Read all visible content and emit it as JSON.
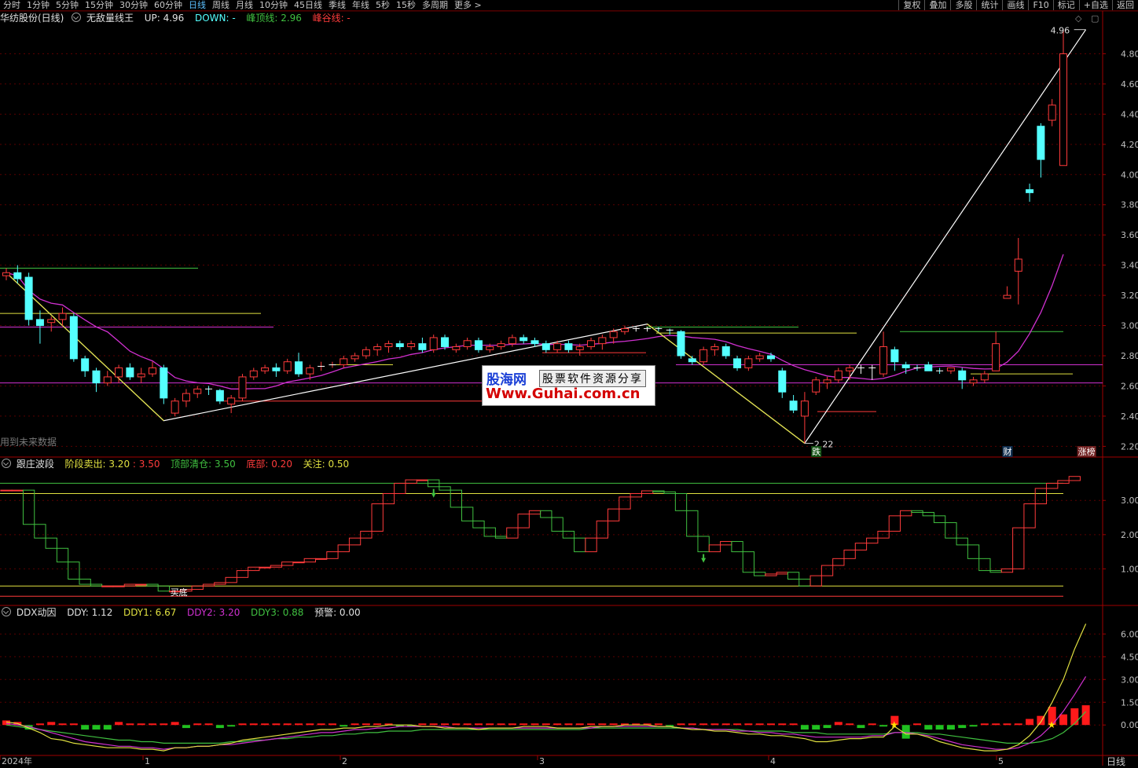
{
  "toolbar": {
    "tabs": [
      "分时",
      "1分钟",
      "5分钟",
      "15分钟",
      "30分钟",
      "60分钟",
      "日线",
      "周线",
      "月线",
      "10分钟",
      "45日线",
      "季线",
      "年线",
      "5秒",
      "15秒",
      "多周期",
      "更多 >"
    ],
    "active_index": 6,
    "right_buttons": [
      "复权",
      "叠加",
      "多股",
      "统计",
      "画线",
      "F10",
      "标记",
      "+自选",
      "返回"
    ]
  },
  "main_panel": {
    "stock_name": "华纺股份(日线)",
    "indicator_name": "无敌量线王",
    "up_label": "UP: 4.96",
    "down_label": "DOWN: -",
    "peak_label": "峰顶线: 2.96",
    "valley_label": "峰谷线: -",
    "future_data_note": "用到未来数据",
    "high_marker": "4.96",
    "low_marker": "2.22",
    "event_labels": [
      "跌",
      "财",
      "涨榜"
    ],
    "colors": {
      "up": "#ff3b3b",
      "down": "#54ffff",
      "ma": "#d030d0",
      "zigzag": "#ffffff",
      "green_line": "#40c040",
      "yellow_line": "#e0e040"
    }
  },
  "wave_panel": {
    "name": "跟庄波段",
    "stage_sell_label": "阶段卖出: 3.20",
    "value2": ": 3.50",
    "top_clear_label": "顶部清仓: 3.50",
    "bottom_label": "底部: 0.20",
    "attention_label": "关注: 0.50",
    "buy_label": "买底"
  },
  "ddx_panel": {
    "name": "DDX动因",
    "ddy_label": "DDY: 1.12",
    "ddy1_label": "DDY1: 6.67",
    "ddy2_label": "DDY2: 3.20",
    "ddy3_label": "DDY3: 0.88",
    "warn_label": "预警: 0.00"
  },
  "x_axis": {
    "labels": [
      "2024年",
      "1",
      "2",
      "3",
      "4",
      "5"
    ],
    "period_label": "日线"
  },
  "watermark": {
    "brand": "股海网",
    "slogan": "股票软件资源分享",
    "url": "Www.Guhai.com.cn"
  },
  "chart_data": [
    {
      "type": "candlestick",
      "title": "华纺股份(日线)",
      "ylim": [
        2.15,
        5.0
      ],
      "y_ticks": [
        2.2,
        2.4,
        2.6,
        2.8,
        3.0,
        3.2,
        3.4,
        3.6,
        3.8,
        4.0,
        4.2,
        4.4,
        4.6,
        4.8
      ],
      "ohlc": [
        [
          3.33,
          3.38,
          3.3,
          3.35
        ],
        [
          3.35,
          3.4,
          3.28,
          3.31
        ],
        [
          3.32,
          3.35,
          3.0,
          3.04
        ],
        [
          3.04,
          3.1,
          2.88,
          3.0
        ],
        [
          3.02,
          3.06,
          2.96,
          3.04
        ],
        [
          3.04,
          3.12,
          3.0,
          3.08
        ],
        [
          3.06,
          3.08,
          2.76,
          2.78
        ],
        [
          2.78,
          2.8,
          2.66,
          2.7
        ],
        [
          2.7,
          2.72,
          2.56,
          2.62
        ],
        [
          2.62,
          2.7,
          2.6,
          2.66
        ],
        [
          2.66,
          2.74,
          2.62,
          2.72
        ],
        [
          2.72,
          2.75,
          2.64,
          2.66
        ],
        [
          2.66,
          2.72,
          2.62,
          2.68
        ],
        [
          2.68,
          2.76,
          2.66,
          2.72
        ],
        [
          2.72,
          2.74,
          2.48,
          2.52
        ],
        [
          2.42,
          2.52,
          2.4,
          2.5
        ],
        [
          2.5,
          2.58,
          2.46,
          2.55
        ],
        [
          2.55,
          2.6,
          2.52,
          2.58
        ],
        [
          2.58,
          2.6,
          2.54,
          2.57
        ],
        [
          2.57,
          2.58,
          2.48,
          2.5
        ],
        [
          2.48,
          2.54,
          2.42,
          2.52
        ],
        [
          2.52,
          2.68,
          2.5,
          2.66
        ],
        [
          2.66,
          2.72,
          2.64,
          2.7
        ],
        [
          2.7,
          2.74,
          2.68,
          2.72
        ],
        [
          2.72,
          2.75,
          2.66,
          2.7
        ],
        [
          2.7,
          2.78,
          2.68,
          2.76
        ],
        [
          2.76,
          2.82,
          2.66,
          2.68
        ],
        [
          2.68,
          2.74,
          2.64,
          2.72
        ],
        [
          2.72,
          2.76,
          2.7,
          2.73
        ],
        [
          2.73,
          2.76,
          2.72,
          2.74
        ],
        [
          2.74,
          2.8,
          2.72,
          2.78
        ],
        [
          2.78,
          2.82,
          2.76,
          2.8
        ],
        [
          2.8,
          2.86,
          2.78,
          2.84
        ],
        [
          2.84,
          2.88,
          2.8,
          2.86
        ],
        [
          2.86,
          2.9,
          2.82,
          2.88
        ],
        [
          2.88,
          2.9,
          2.84,
          2.86
        ],
        [
          2.86,
          2.9,
          2.84,
          2.88
        ],
        [
          2.88,
          2.92,
          2.82,
          2.84
        ],
        [
          2.84,
          2.94,
          2.82,
          2.92
        ],
        [
          2.92,
          2.94,
          2.84,
          2.86
        ],
        [
          2.84,
          2.88,
          2.82,
          2.86
        ],
        [
          2.86,
          2.92,
          2.84,
          2.9
        ],
        [
          2.9,
          2.92,
          2.82,
          2.84
        ],
        [
          2.84,
          2.88,
          2.82,
          2.86
        ],
        [
          2.86,
          2.9,
          2.84,
          2.88
        ],
        [
          2.88,
          2.94,
          2.86,
          2.92
        ],
        [
          2.92,
          2.94,
          2.88,
          2.9
        ],
        [
          2.9,
          2.92,
          2.86,
          2.88
        ],
        [
          2.88,
          2.9,
          2.82,
          2.84
        ],
        [
          2.84,
          2.9,
          2.82,
          2.88
        ],
        [
          2.88,
          2.9,
          2.82,
          2.84
        ],
        [
          2.84,
          2.88,
          2.8,
          2.86
        ],
        [
          2.86,
          2.92,
          2.84,
          2.9
        ],
        [
          2.88,
          2.94,
          2.84,
          2.92
        ],
        [
          2.92,
          2.98,
          2.88,
          2.96
        ],
        [
          2.96,
          3.0,
          2.94,
          2.98
        ],
        [
          2.98,
          2.99,
          2.96,
          2.98
        ],
        [
          2.98,
          2.99,
          2.96,
          2.98
        ],
        [
          2.98,
          2.99,
          2.96,
          2.97
        ],
        [
          2.97,
          2.98,
          2.94,
          2.96
        ],
        [
          2.96,
          2.97,
          2.78,
          2.8
        ],
        [
          2.78,
          2.8,
          2.74,
          2.76
        ],
        [
          2.76,
          2.86,
          2.74,
          2.84
        ],
        [
          2.84,
          2.88,
          2.8,
          2.86
        ],
        [
          2.86,
          2.88,
          2.78,
          2.8
        ],
        [
          2.78,
          2.8,
          2.7,
          2.72
        ],
        [
          2.72,
          2.8,
          2.7,
          2.78
        ],
        [
          2.78,
          2.82,
          2.76,
          2.8
        ],
        [
          2.8,
          2.82,
          2.76,
          2.78
        ],
        [
          2.7,
          2.72,
          2.52,
          2.56
        ],
        [
          2.5,
          2.54,
          2.42,
          2.44
        ],
        [
          2.4,
          2.56,
          2.22,
          2.5
        ],
        [
          2.56,
          2.66,
          2.54,
          2.64
        ],
        [
          2.62,
          2.66,
          2.58,
          2.64
        ],
        [
          2.64,
          2.72,
          2.62,
          2.7
        ],
        [
          2.7,
          2.74,
          2.64,
          2.72
        ],
        [
          2.72,
          2.74,
          2.68,
          2.72
        ],
        [
          2.72,
          2.74,
          2.64,
          2.72
        ],
        [
          2.68,
          2.96,
          2.66,
          2.86
        ],
        [
          2.84,
          2.86,
          2.7,
          2.76
        ],
        [
          2.74,
          2.76,
          2.68,
          2.72
        ],
        [
          2.72,
          2.74,
          2.7,
          2.71
        ],
        [
          2.74,
          2.76,
          2.7,
          2.7
        ],
        [
          2.7,
          2.72,
          2.68,
          2.69
        ],
        [
          2.7,
          2.72,
          2.68,
          2.72
        ],
        [
          2.7,
          2.72,
          2.58,
          2.64
        ],
        [
          2.62,
          2.66,
          2.6,
          2.64
        ],
        [
          2.64,
          2.7,
          2.62,
          2.68
        ],
        [
          2.7,
          2.96,
          2.7,
          2.88
        ],
        [
          3.18,
          3.26,
          3.18,
          3.2
        ],
        [
          3.36,
          3.58,
          3.14,
          3.44
        ],
        [
          3.9,
          3.94,
          3.82,
          3.88
        ],
        [
          4.32,
          4.34,
          3.98,
          4.1
        ],
        [
          4.36,
          4.5,
          4.32,
          4.46
        ],
        [
          4.06,
          4.96,
          4.06,
          4.8
        ]
      ]
    },
    {
      "type": "step",
      "title": "跟庄波段",
      "ylim": [
        0,
        3.9
      ],
      "y_ticks": [
        1.0,
        2.0,
        3.0
      ],
      "levels": {
        "top": 3.5,
        "sell": 3.2,
        "bottom": 0.2,
        "attention": 0.5
      },
      "values": [
        3.3,
        3.3,
        2.3,
        1.9,
        1.6,
        1.2,
        0.7,
        0.55,
        0.5,
        0.5,
        0.5,
        0.55,
        0.55,
        0.5,
        0.35,
        0.35,
        0.4,
        0.5,
        0.55,
        0.6,
        0.75,
        0.95,
        1.05,
        1.05,
        1.1,
        1.2,
        1.2,
        1.3,
        1.3,
        1.5,
        1.7,
        1.9,
        2.1,
        2.9,
        3.2,
        3.5,
        3.6,
        3.6,
        3.4,
        3.3,
        2.8,
        2.4,
        2.2,
        1.95,
        1.9,
        2.2,
        2.6,
        2.7,
        2.5,
        2.1,
        1.9,
        1.5,
        1.9,
        2.4,
        2.75,
        3.1,
        3.2,
        3.28,
        3.25,
        3.2,
        2.7,
        1.95,
        1.5,
        1.7,
        1.8,
        1.5,
        0.9,
        0.8,
        0.85,
        0.9,
        0.7,
        0.5,
        0.8,
        1.1,
        1.3,
        1.55,
        1.75,
        1.9,
        2.1,
        2.55,
        2.7,
        2.65,
        2.55,
        2.35,
        1.9,
        1.7,
        1.3,
        0.95,
        0.9,
        1.0,
        2.2,
        2.9,
        3.35,
        3.5,
        3.58,
        3.7
      ]
    },
    {
      "type": "bar_line",
      "title": "DDX动因",
      "ylim": [
        -1.8,
        7.0
      ],
      "y_ticks": [
        0.0,
        1.5,
        3.0,
        4.5,
        6.0
      ],
      "bars": [
        0.3,
        0.2,
        -0.3,
        0.1,
        0.2,
        0.1,
        0.1,
        -0.3,
        -0.3,
        -0.3,
        0.2,
        0.1,
        0.1,
        0.1,
        0.1,
        0.2,
        -0.2,
        0.1,
        0.1,
        -0.2,
        -0.1,
        0.1,
        0.1,
        0.1,
        0.1,
        0.1,
        0.1,
        0.1,
        0.1,
        0.1,
        -0.1,
        0.1,
        0.1,
        0.1,
        0.1,
        -0.1,
        -0.1,
        0.1,
        0.1,
        0.1,
        0.1,
        0.1,
        0.1,
        0.1,
        0.1,
        0.1,
        0.1,
        0.1,
        0.1,
        0.1,
        0.1,
        0.1,
        0.1,
        0.1,
        0.1,
        0.1,
        0.1,
        0.1,
        0.1,
        -0.1,
        0.1,
        0.1,
        0.1,
        0.1,
        0.1,
        0.1,
        0.1,
        0.1,
        0.1,
        0.1,
        0.1,
        -0.3,
        -0.3,
        -0.2,
        0.2,
        0.1,
        -0.2,
        0.1,
        -0.1,
        0.6,
        -0.9,
        0.1,
        -0.3,
        -0.3,
        -0.3,
        -0.2,
        -0.1,
        0.1,
        0.1,
        0.1,
        0.1,
        0.4,
        0.6,
        1.2,
        0.7,
        1.1,
        1.3
      ],
      "line_ddy1": [
        0.2,
        0.1,
        -0.2,
        -0.5,
        -0.9,
        -1.0,
        -1.2,
        -1.3,
        -1.4,
        -1.5,
        -1.5,
        -1.5,
        -1.6,
        -1.6,
        -1.7,
        -1.5,
        -1.5,
        -1.4,
        -1.4,
        -1.3,
        -1.2,
        -1.0,
        -0.9,
        -0.8,
        -0.7,
        -0.6,
        -0.5,
        -0.4,
        -0.3,
        -0.3,
        -0.2,
        -0.2,
        -0.1,
        -0.1,
        0.0,
        0.0,
        0.0,
        -0.1,
        -0.1,
        -0.2,
        -0.2,
        -0.2,
        -0.3,
        -0.2,
        -0.2,
        -0.2,
        -0.1,
        -0.1,
        -0.1,
        -0.2,
        -0.2,
        -0.2,
        -0.1,
        -0.1,
        -0.1,
        0.0,
        0.0,
        0.0,
        -0.1,
        -0.1,
        -0.2,
        -0.3,
        -0.3,
        -0.4,
        -0.4,
        -0.5,
        -0.6,
        -0.6,
        -0.7,
        -0.7,
        -0.8,
        -0.9,
        -1.1,
        -1.1,
        -1.0,
        -0.9,
        -0.9,
        -0.8,
        -0.8,
        -0.1,
        -0.6,
        -0.6,
        -0.8,
        -1.1,
        -1.3,
        -1.5,
        -1.6,
        -1.7,
        -1.7,
        -1.6,
        -1.3,
        -0.7,
        0.2,
        1.5,
        3.0,
        5.0,
        6.67
      ],
      "line_ddy2": [
        0.1,
        0.0,
        -0.1,
        -0.3,
        -0.5,
        -0.7,
        -0.9,
        -1.1,
        -1.2,
        -1.3,
        -1.4,
        -1.4,
        -1.5,
        -1.5,
        -1.6,
        -1.5,
        -1.5,
        -1.4,
        -1.4,
        -1.3,
        -1.3,
        -1.2,
        -1.1,
        -1.0,
        -0.9,
        -0.8,
        -0.7,
        -0.6,
        -0.5,
        -0.5,
        -0.4,
        -0.3,
        -0.3,
        -0.2,
        -0.2,
        -0.1,
        -0.1,
        -0.1,
        -0.1,
        -0.1,
        -0.2,
        -0.2,
        -0.2,
        -0.2,
        -0.2,
        -0.2,
        -0.2,
        -0.2,
        -0.2,
        -0.2,
        -0.2,
        -0.2,
        -0.2,
        -0.1,
        -0.1,
        -0.1,
        -0.1,
        -0.1,
        -0.1,
        -0.1,
        -0.2,
        -0.2,
        -0.3,
        -0.3,
        -0.3,
        -0.4,
        -0.4,
        -0.5,
        -0.5,
        -0.6,
        -0.6,
        -0.7,
        -0.8,
        -0.8,
        -0.8,
        -0.8,
        -0.8,
        -0.7,
        -0.7,
        -0.5,
        -0.5,
        -0.6,
        -0.7,
        -0.9,
        -1.1,
        -1.3,
        -1.4,
        -1.5,
        -1.6,
        -1.6,
        -1.5,
        -1.2,
        -0.7,
        0.0,
        0.9,
        2.0,
        3.2
      ],
      "line_ddy3": [
        0.0,
        -0.1,
        -0.2,
        -0.3,
        -0.4,
        -0.5,
        -0.6,
        -0.7,
        -0.8,
        -0.9,
        -1.0,
        -1.0,
        -1.1,
        -1.1,
        -1.2,
        -1.2,
        -1.2,
        -1.2,
        -1.2,
        -1.2,
        -1.1,
        -1.1,
        -1.0,
        -1.0,
        -0.9,
        -0.9,
        -0.8,
        -0.8,
        -0.7,
        -0.7,
        -0.6,
        -0.6,
        -0.5,
        -0.5,
        -0.4,
        -0.4,
        -0.4,
        -0.3,
        -0.3,
        -0.3,
        -0.3,
        -0.3,
        -0.3,
        -0.3,
        -0.3,
        -0.3,
        -0.3,
        -0.3,
        -0.3,
        -0.3,
        -0.3,
        -0.3,
        -0.2,
        -0.2,
        -0.2,
        -0.2,
        -0.2,
        -0.2,
        -0.2,
        -0.2,
        -0.2,
        -0.2,
        -0.3,
        -0.3,
        -0.3,
        -0.3,
        -0.4,
        -0.4,
        -0.4,
        -0.4,
        -0.5,
        -0.5,
        -0.5,
        -0.6,
        -0.6,
        -0.6,
        -0.6,
        -0.6,
        -0.6,
        -0.5,
        -0.5,
        -0.5,
        -0.6,
        -0.6,
        -0.7,
        -0.8,
        -0.9,
        -1.0,
        -1.1,
        -1.2,
        -1.2,
        -1.2,
        -1.1,
        -0.9,
        -0.5,
        0.1,
        0.88
      ]
    }
  ]
}
